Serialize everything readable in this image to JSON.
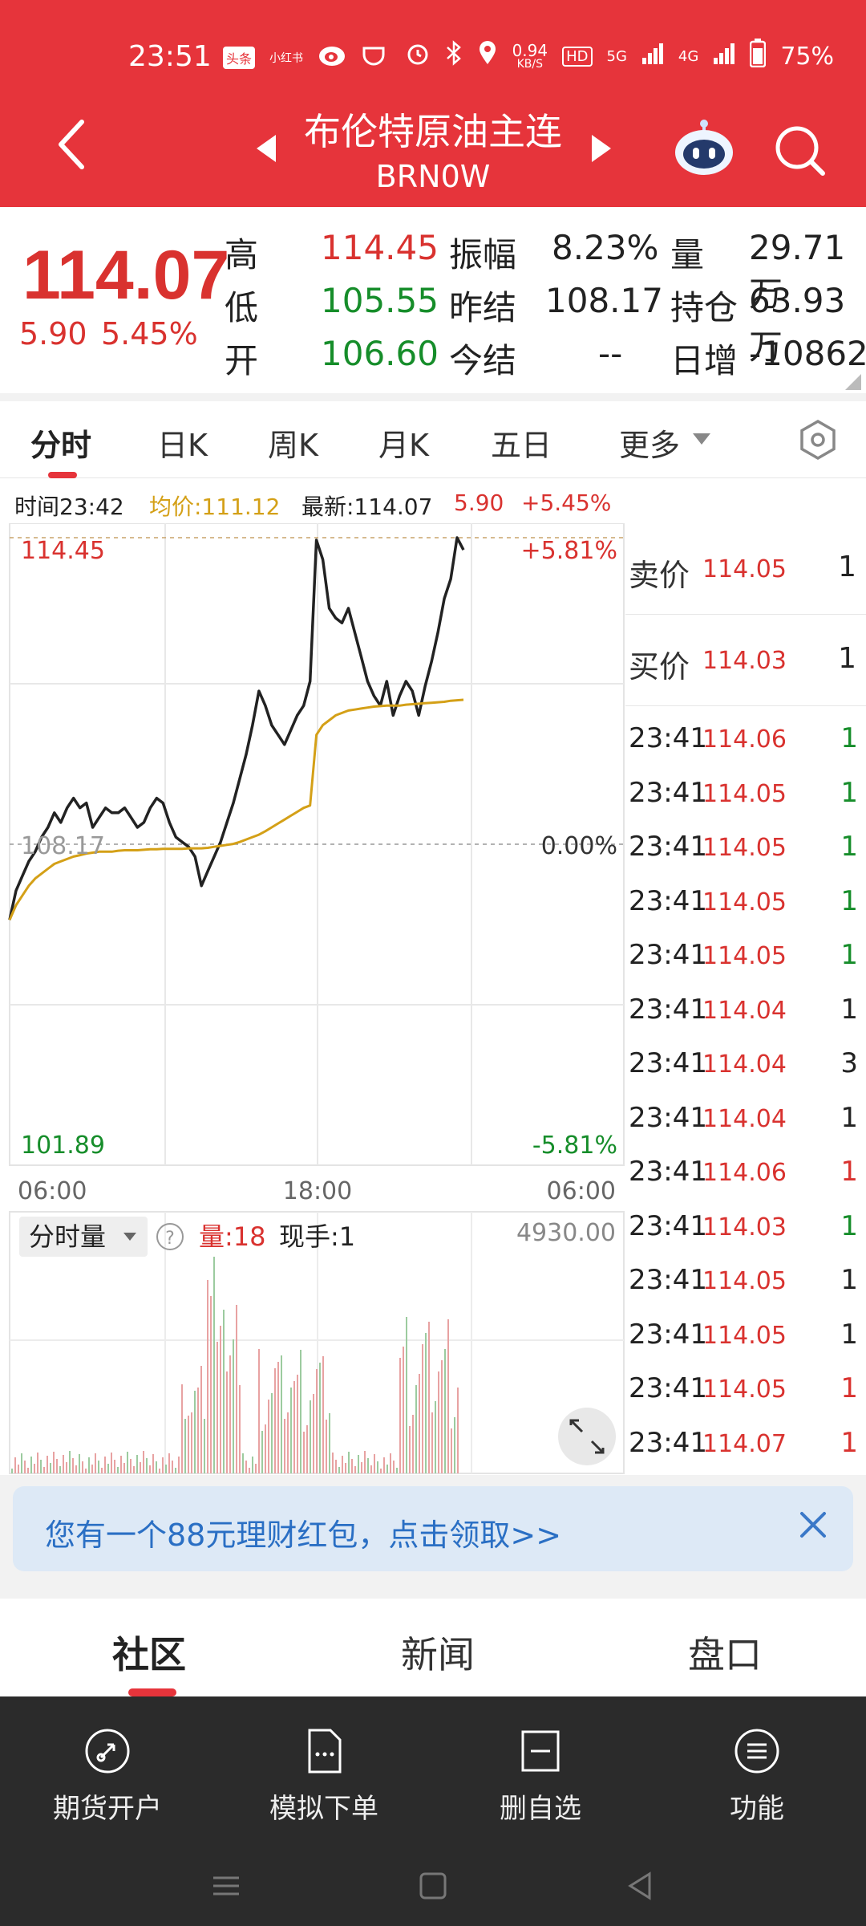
{
  "status": {
    "time": "23:51",
    "app_badges": [
      "头条",
      "小红书"
    ],
    "net_speed": "0.94",
    "net_unit": "KB/S",
    "hd": "HD",
    "sig1": "5G",
    "sig2": "4G",
    "battery": "75%"
  },
  "header": {
    "title": "布伦特原油主连",
    "code": "BRN0W"
  },
  "quote": {
    "price": "114.07",
    "change": "5.90",
    "change_pct": "5.45%",
    "high_label": "高",
    "high": "114.45",
    "low_label": "低",
    "low": "105.55",
    "open_label": "开",
    "open": "106.60",
    "amp_label": "振幅",
    "amp": "8.23%",
    "prev_label": "昨结",
    "prev": "108.17",
    "today_label": "今结",
    "today": "--",
    "vol_label": "量",
    "vol": "29.71万",
    "oi_label": "持仓",
    "oi": "63.93万",
    "inc_label": "日增",
    "inc": "-10862"
  },
  "tabs": [
    "分时",
    "日K",
    "周K",
    "月K",
    "五日",
    "更多"
  ],
  "info": {
    "time": "时间23:42",
    "avg": "均价:111.12",
    "last": "最新:114.07",
    "chg": "5.90",
    "pct": "+5.45%"
  },
  "chart": {
    "top_price": "114.45",
    "top_pct": "+5.81%",
    "mid_price": "108.17",
    "mid_pct": "0.00%",
    "bot_price": "101.89",
    "bot_pct": "-5.81%",
    "x_labels": [
      "06:00",
      "18:00",
      "06:00"
    ],
    "vol_tab": "分时量",
    "vol_help": "?",
    "vol_label": "量:18",
    "cur_hand": "现手:1",
    "vol_max": "4930.00"
  },
  "chart_data": {
    "type": "line",
    "series": [
      {
        "values": [
          106.6,
          107.2,
          107.5,
          107.8,
          108.0,
          108.3,
          108.5,
          108.8,
          108.6,
          108.9,
          109.1,
          108.9,
          109.0,
          108.5,
          108.7,
          108.9,
          108.8,
          108.8,
          108.9,
          108.7,
          108.5,
          108.6,
          108.9,
          109.1,
          109.0,
          108.6,
          108.3,
          108.2,
          108.1,
          107.9,
          107.3,
          107.6,
          107.9,
          108.2,
          108.6,
          109.0,
          109.5,
          110.0,
          110.6,
          111.3,
          111.0,
          110.6,
          110.4,
          110.2,
          110.5,
          110.8,
          111.0,
          111.5,
          114.4,
          114.0,
          113.0,
          112.8,
          112.7,
          113.0,
          112.5,
          112.0,
          111.5,
          111.2,
          111.0,
          111.5,
          110.8,
          111.2,
          111.5,
          111.3,
          110.8,
          111.4,
          111.9,
          112.5,
          113.2,
          113.6,
          114.45,
          114.2
        ]
      },
      {
        "values": [
          106.6,
          106.9,
          107.1,
          107.3,
          107.45,
          107.55,
          107.65,
          107.75,
          107.8,
          107.85,
          107.9,
          107.93,
          107.96,
          107.98,
          108.0,
          108.0,
          108.0,
          108.02,
          108.03,
          108.03,
          108.03,
          108.04,
          108.05,
          108.05,
          108.06,
          108.06,
          108.06,
          108.06,
          108.07,
          108.07,
          108.07,
          108.08,
          108.1,
          108.12,
          108.14,
          108.16,
          108.2,
          108.25,
          108.3,
          108.35,
          108.42,
          108.5,
          108.58,
          108.66,
          108.74,
          108.82,
          108.9,
          108.95,
          110.4,
          110.6,
          110.7,
          110.8,
          110.85,
          110.9,
          110.92,
          110.94,
          110.96,
          110.98,
          110.99,
          111.0,
          111.0,
          111.0,
          111.02,
          111.03,
          111.04,
          111.05,
          111.06,
          111.07,
          111.08,
          111.1,
          111.11,
          111.12
        ]
      }
    ],
    "ylim": [
      101.89,
      114.45
    ],
    "colors": {
      "price": "#222222",
      "avg": "#d4a017"
    }
  },
  "ask": [
    {
      "label": "卖价",
      "price": "114.05",
      "qty": "1"
    },
    {
      "label": "买价",
      "price": "114.03",
      "qty": "1"
    }
  ],
  "trades": [
    {
      "t": "23:41",
      "p": "114.06",
      "q": "1",
      "c": "green"
    },
    {
      "t": "23:41",
      "p": "114.05",
      "q": "1",
      "c": "green"
    },
    {
      "t": "23:41",
      "p": "114.05",
      "q": "1",
      "c": "green"
    },
    {
      "t": "23:41",
      "p": "114.05",
      "q": "1",
      "c": "green"
    },
    {
      "t": "23:41",
      "p": "114.05",
      "q": "1",
      "c": "green"
    },
    {
      "t": "23:41",
      "p": "114.04",
      "q": "1",
      "c": "black"
    },
    {
      "t": "23:41",
      "p": "114.04",
      "q": "3",
      "c": "black"
    },
    {
      "t": "23:41",
      "p": "114.04",
      "q": "1",
      "c": "black"
    },
    {
      "t": "23:41",
      "p": "114.06",
      "q": "1",
      "c": "red"
    },
    {
      "t": "23:41",
      "p": "114.03",
      "q": "1",
      "c": "green"
    },
    {
      "t": "23:41",
      "p": "114.05",
      "q": "1",
      "c": "black"
    },
    {
      "t": "23:41",
      "p": "114.05",
      "q": "1",
      "c": "black"
    },
    {
      "t": "23:41",
      "p": "114.05",
      "q": "1",
      "c": "red"
    },
    {
      "t": "23:41",
      "p": "114.07",
      "q": "1",
      "c": "red"
    }
  ],
  "banner": {
    "text": "您有一个88元理财红包，点击领取>>"
  },
  "bottom_tabs": [
    "社区",
    "新闻",
    "盘口"
  ],
  "bottom_bar": [
    "期货开户",
    "模拟下单",
    "删自选",
    "功能"
  ],
  "icons": {
    "back": "back-icon",
    "robot": "robot-icon",
    "search": "search-icon",
    "settings": "settings-icon",
    "expand": "expand-icon",
    "close": "close-icon"
  }
}
